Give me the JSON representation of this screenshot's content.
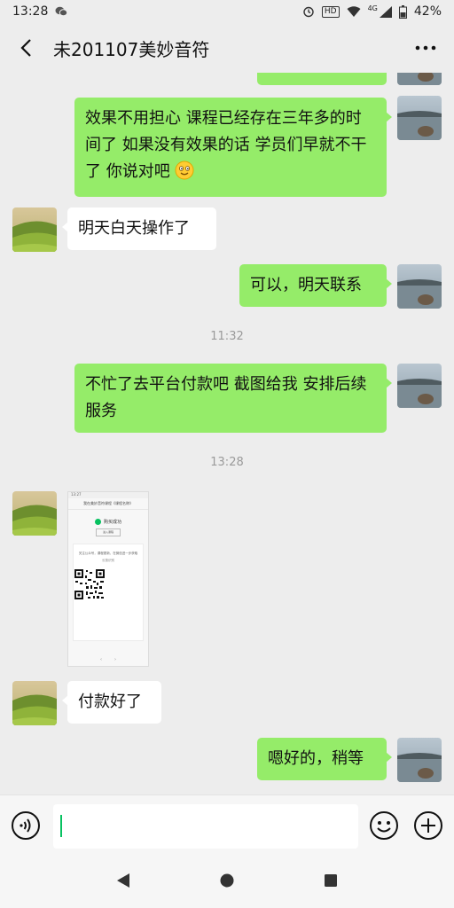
{
  "status_bar": {
    "time": "13:28",
    "network": "4G",
    "battery": "42%",
    "icons": [
      "wechat-notification-icon",
      "alarm-icon",
      "hd-icon",
      "wifi-icon",
      "signal-icon",
      "battery-icon"
    ]
  },
  "header": {
    "title": "未201107美妙音符",
    "back_icon": "chevron-left-icon",
    "more_icon": "more-dots-icon"
  },
  "messages": [
    {
      "side": "out",
      "type": "text",
      "text": "效果不用担心 课程已经存在三年多的时间了 如果没有效果的话 学员们早就不干了 你说对吧 ",
      "emoji": "smile-emoji"
    },
    {
      "side": "in",
      "type": "text",
      "text": "明天白天操作了"
    },
    {
      "side": "out",
      "type": "text",
      "text": "可以，明天联系"
    },
    {
      "type": "time",
      "text": "11:32"
    },
    {
      "side": "out",
      "type": "text",
      "text": "不忙了去平台付款吧 截图给我 安排后续服务"
    },
    {
      "type": "time",
      "text": "13:28"
    },
    {
      "side": "in",
      "type": "image",
      "image": {
        "status_time": "13:27",
        "title": "我在美妙音符课程《课程名称》",
        "success_text": "购买成功",
        "button_text": "进入课程",
        "note": "关注公众号，课程更新，在微信进一步获取",
        "qr_caption": "长按识别"
      }
    },
    {
      "side": "in",
      "type": "text",
      "text": "付款好了"
    },
    {
      "side": "out",
      "type": "text",
      "text": "嗯好的，稍等"
    }
  ],
  "input_bar": {
    "voice_icon": "voice-icon",
    "emoji_icon": "emoji-icon",
    "plus_icon": "plus-circle-icon",
    "text_value": ""
  },
  "nav_bar": {
    "back_icon": "triangle-back-icon",
    "home_icon": "circle-home-icon",
    "recents_icon": "square-recents-icon"
  },
  "colors": {
    "outgoing_bubble": "#95ec69",
    "incoming_bubble": "#ffffff",
    "background": "#ededed",
    "accent": "#07c160"
  }
}
